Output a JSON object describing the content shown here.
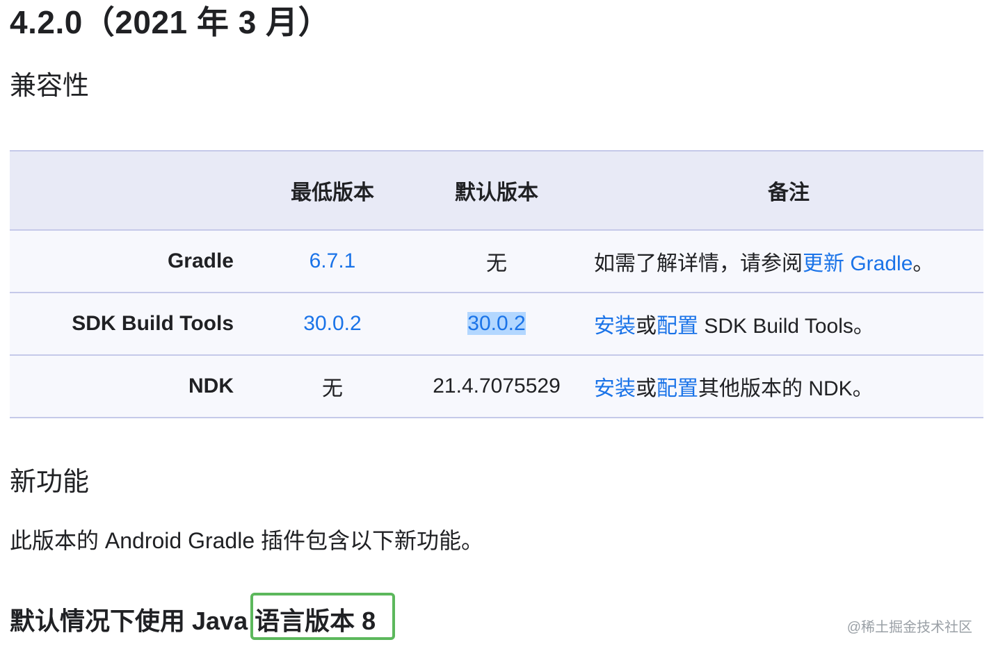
{
  "page": {
    "title": "4.2.0（2021 年 3 月）"
  },
  "compatibility": {
    "heading": "兼容性",
    "table": {
      "headers": {
        "component": "",
        "min_version": "最低版本",
        "default_version": "默认版本",
        "notes": "备注"
      },
      "rows": [
        {
          "component": "Gradle",
          "min_version": "6.7.1",
          "default_version": "无",
          "notes": {
            "prefix": "如需了解详情，请参阅",
            "link": "更新 Gradle",
            "suffix": "。"
          }
        },
        {
          "component": "SDK Build Tools",
          "min_version": "30.0.2",
          "default_version": "30.0.2",
          "notes": {
            "link1": "安装",
            "middle": "或",
            "link2": "配置",
            "suffix": " SDK Build Tools。"
          }
        },
        {
          "component": "NDK",
          "min_version": "无",
          "default_version": "21.4.7075529",
          "notes": {
            "link1": "安装",
            "middle": "或",
            "link2": "配置",
            "suffix": "其他版本的 NDK。"
          }
        }
      ]
    }
  },
  "features": {
    "heading": "新功能",
    "intro": "此版本的 Android Gradle 插件包含以下新功能。",
    "subheading": "默认情况下使用 Java 语言版本 8"
  },
  "watermark": "@稀土掘金技术社区",
  "colors": {
    "link": "#1a73e8",
    "table_header_bg": "#e8eaf6",
    "selection": "#b3d7ff",
    "highlight_box": "#5cb85c"
  }
}
